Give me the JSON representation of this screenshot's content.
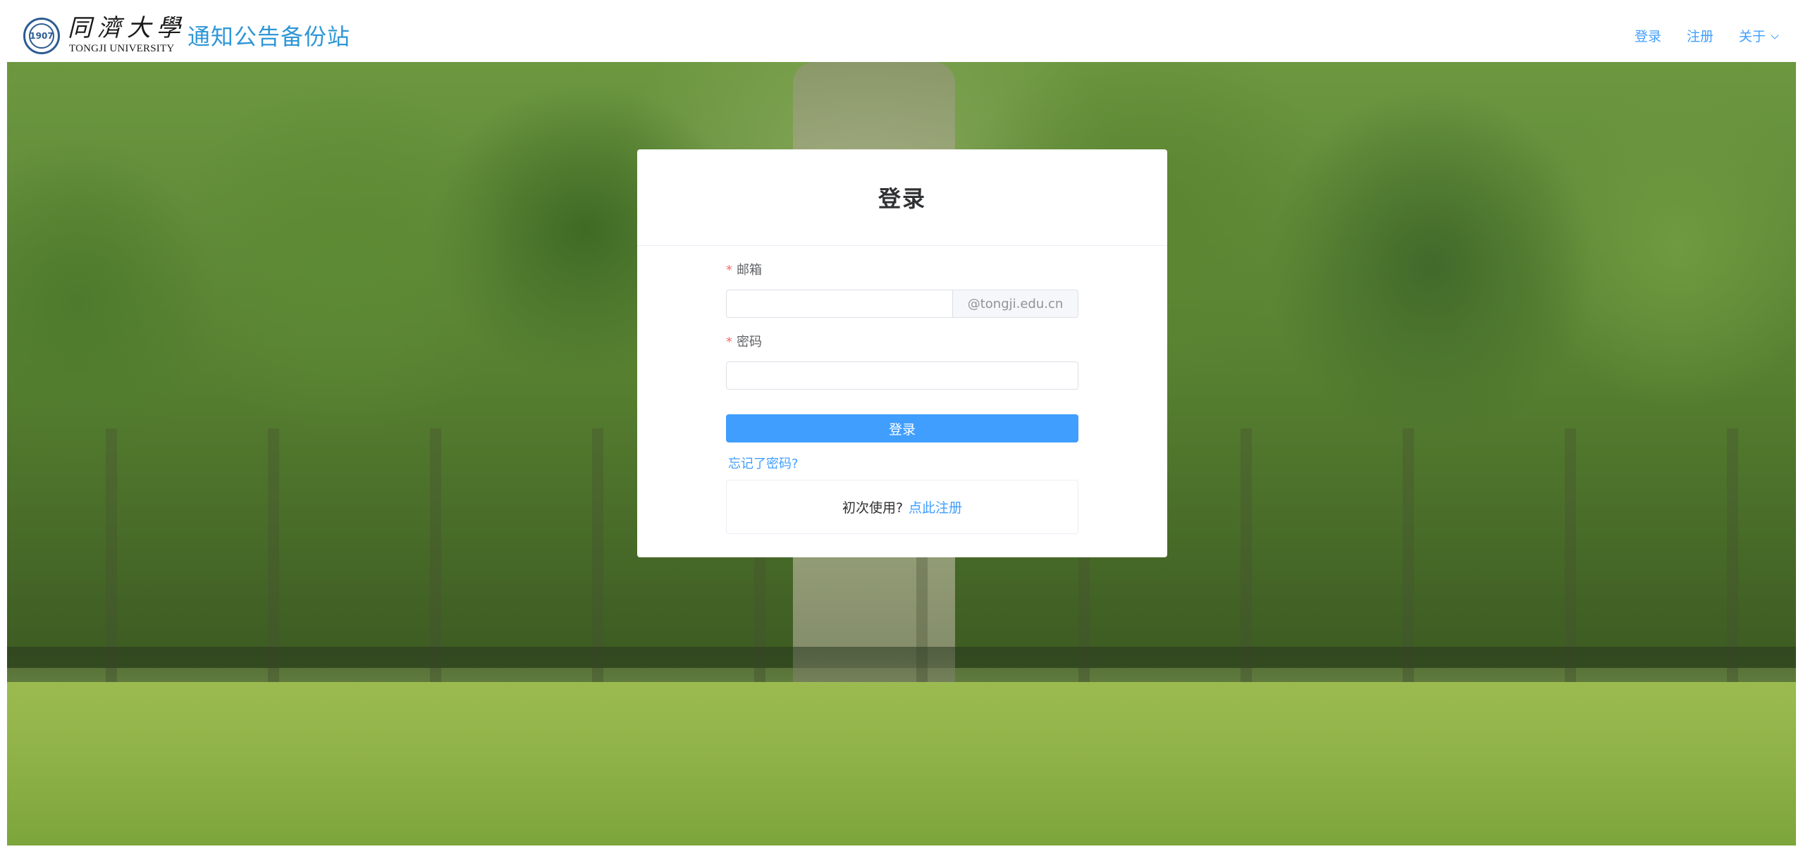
{
  "header": {
    "logo": {
      "name_cn": "同濟大學",
      "name_en": "TONGJI UNIVERSITY",
      "emblem_text": "1907"
    },
    "site_title": "通知公告备份站",
    "nav": {
      "login": "登录",
      "register": "注册",
      "about": "关于"
    }
  },
  "login_card": {
    "title": "登录",
    "email": {
      "required_mark": "*",
      "label": "邮箱",
      "value": "",
      "placeholder": "",
      "suffix": "@tongji.edu.cn"
    },
    "password": {
      "required_mark": "*",
      "label": "密码",
      "value": "",
      "placeholder": ""
    },
    "submit_label": "登录",
    "forgot_password": "忘记了密码?",
    "first_time_text": "初次使用?",
    "register_link": "点此注册"
  },
  "colors": {
    "primary": "#409eff",
    "site_title": "#2f97d6",
    "required": "#f56c6c",
    "text": "#303133"
  }
}
